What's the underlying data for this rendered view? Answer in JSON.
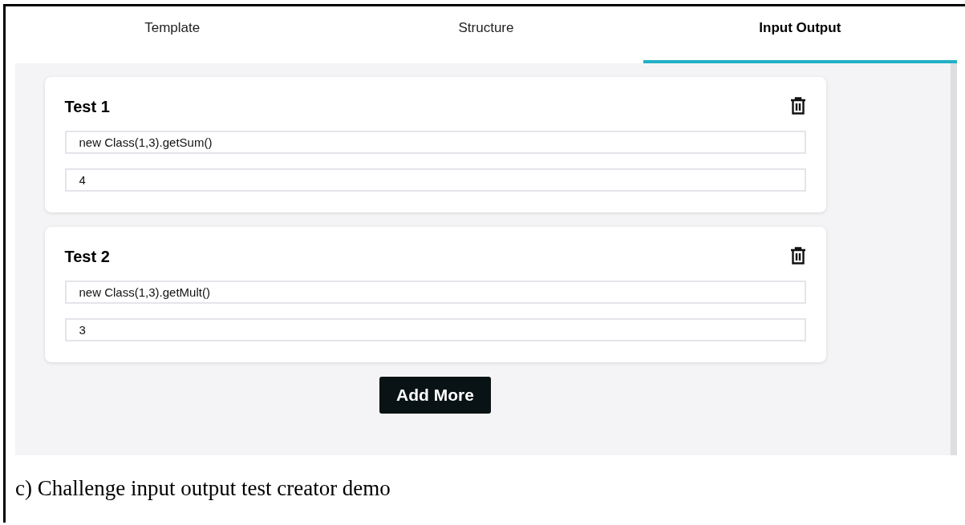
{
  "tabs": [
    {
      "label": "Template",
      "selected": false
    },
    {
      "label": "Structure",
      "selected": false
    },
    {
      "label": "Input Output",
      "selected": true
    }
  ],
  "tests": [
    {
      "title": "Test 1",
      "input": "new Class(1,3).getSum()",
      "output": "4"
    },
    {
      "title": "Test 2",
      "input": "new Class(1,3).getMult()",
      "output": "3"
    }
  ],
  "add_button": "Add More",
  "caption": "c) Challenge input output test creator demo"
}
